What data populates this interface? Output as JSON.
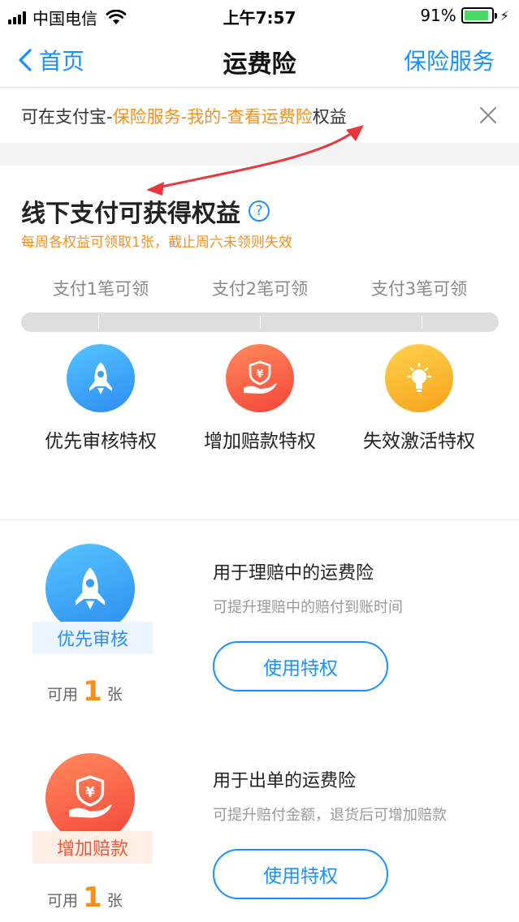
{
  "status_bar": {
    "carrier": "中国电信",
    "time": "上午7:57",
    "battery": "91%",
    "battery_level": 0.91
  },
  "nav": {
    "back_label": "首页",
    "title": "运费险",
    "right_label": "保险服务"
  },
  "notice": {
    "prefix": "可在支付宝-",
    "highlight": "保险服务-我的-查看运费险",
    "suffix": "权益"
  },
  "rights": {
    "title": "线下支付可获得权益",
    "help_glyph": "?",
    "subtitle": "每周各权益可领取1张，截止周六未领则失效",
    "steps": [
      "支付1笔可领",
      "支付2笔可领",
      "支付3笔可领"
    ],
    "progress": 0,
    "privileges": [
      {
        "label": "优先审核特权",
        "icon": "rocket-icon",
        "color": "#2d8cf0"
      },
      {
        "label": "增加赔款特权",
        "icon": "yuan-shield-hand-icon",
        "color": "#f4453a"
      },
      {
        "label": "失效激活特权",
        "icon": "lightbulb-icon",
        "color": "#f7a21b"
      }
    ]
  },
  "cards": [
    {
      "badge": "优先审核",
      "avail_prefix": "可用",
      "count": "1",
      "avail_suffix": "张",
      "title": "用于理赔中的运费险",
      "desc": "可提升理赔中的赔付到账时间",
      "button": "使用特权"
    },
    {
      "badge": "增加赔款",
      "avail_prefix": "可用",
      "count": "1",
      "avail_suffix": "张",
      "title": "用于出单的运费险",
      "desc": "可提升赔付金额，退货后可增加赔款",
      "button": "使用特权"
    }
  ],
  "colors": {
    "accent": "#1890ff",
    "highlight": "#f5901e",
    "annotation_arrow": "#e8383d"
  }
}
